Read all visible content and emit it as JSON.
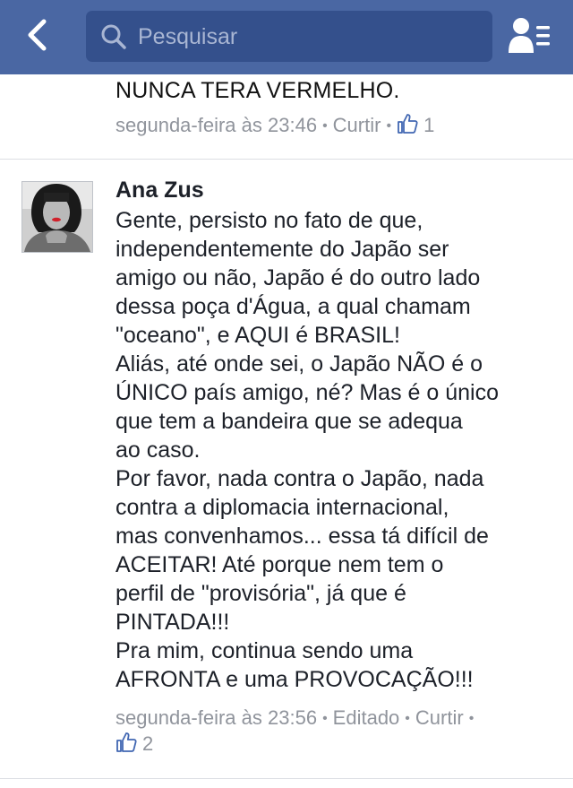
{
  "topbar": {
    "search_placeholder": "Pesquisar",
    "back_icon": "chevron-left-icon",
    "search_icon": "search-icon",
    "friends_icon": "friend-requests-icon",
    "background": "#4a67a3",
    "search_background": "#34508c"
  },
  "previous_comment": {
    "text_tail": "NUNCA TERA VERMELHO.",
    "timestamp": "segunda-feira às 23:46",
    "like_label": "Curtir",
    "like_count": "1"
  },
  "comment": {
    "author": "Ana Zus",
    "lines": [
      "Gente, persisto no fato de que,",
      "independentemente do Japão ser",
      "amigo ou não, Japão é do outro lado",
      "dessa poça d'Água, a qual chamam",
      "\"oceano\", e AQUI é BRASIL!",
      "Aliás, até onde sei, o Japão NÃO é o",
      "ÚNICO país amigo, né? Mas é o único",
      "que tem a bandeira  que se adequa",
      "ao caso.",
      "Por favor, nada contra o Japão, nada",
      "contra a diplomacia internacional,",
      "mas convenhamos... essa tá difícil de",
      "ACEITAR! Até porque nem tem o",
      "perfil de \"provisória\", já que é",
      "PINTADA!!!",
      "Pra mim, continua sendo uma",
      "AFRONTA e uma PROVOCAÇÃO!!!"
    ],
    "timestamp": "segunda-feira às 23:56",
    "edited_label": "Editado",
    "like_label": "Curtir",
    "like_count": "2"
  },
  "colors": {
    "meta_text": "#90949c",
    "like_blue": "#4267b2",
    "divider": "#dcdee3"
  }
}
